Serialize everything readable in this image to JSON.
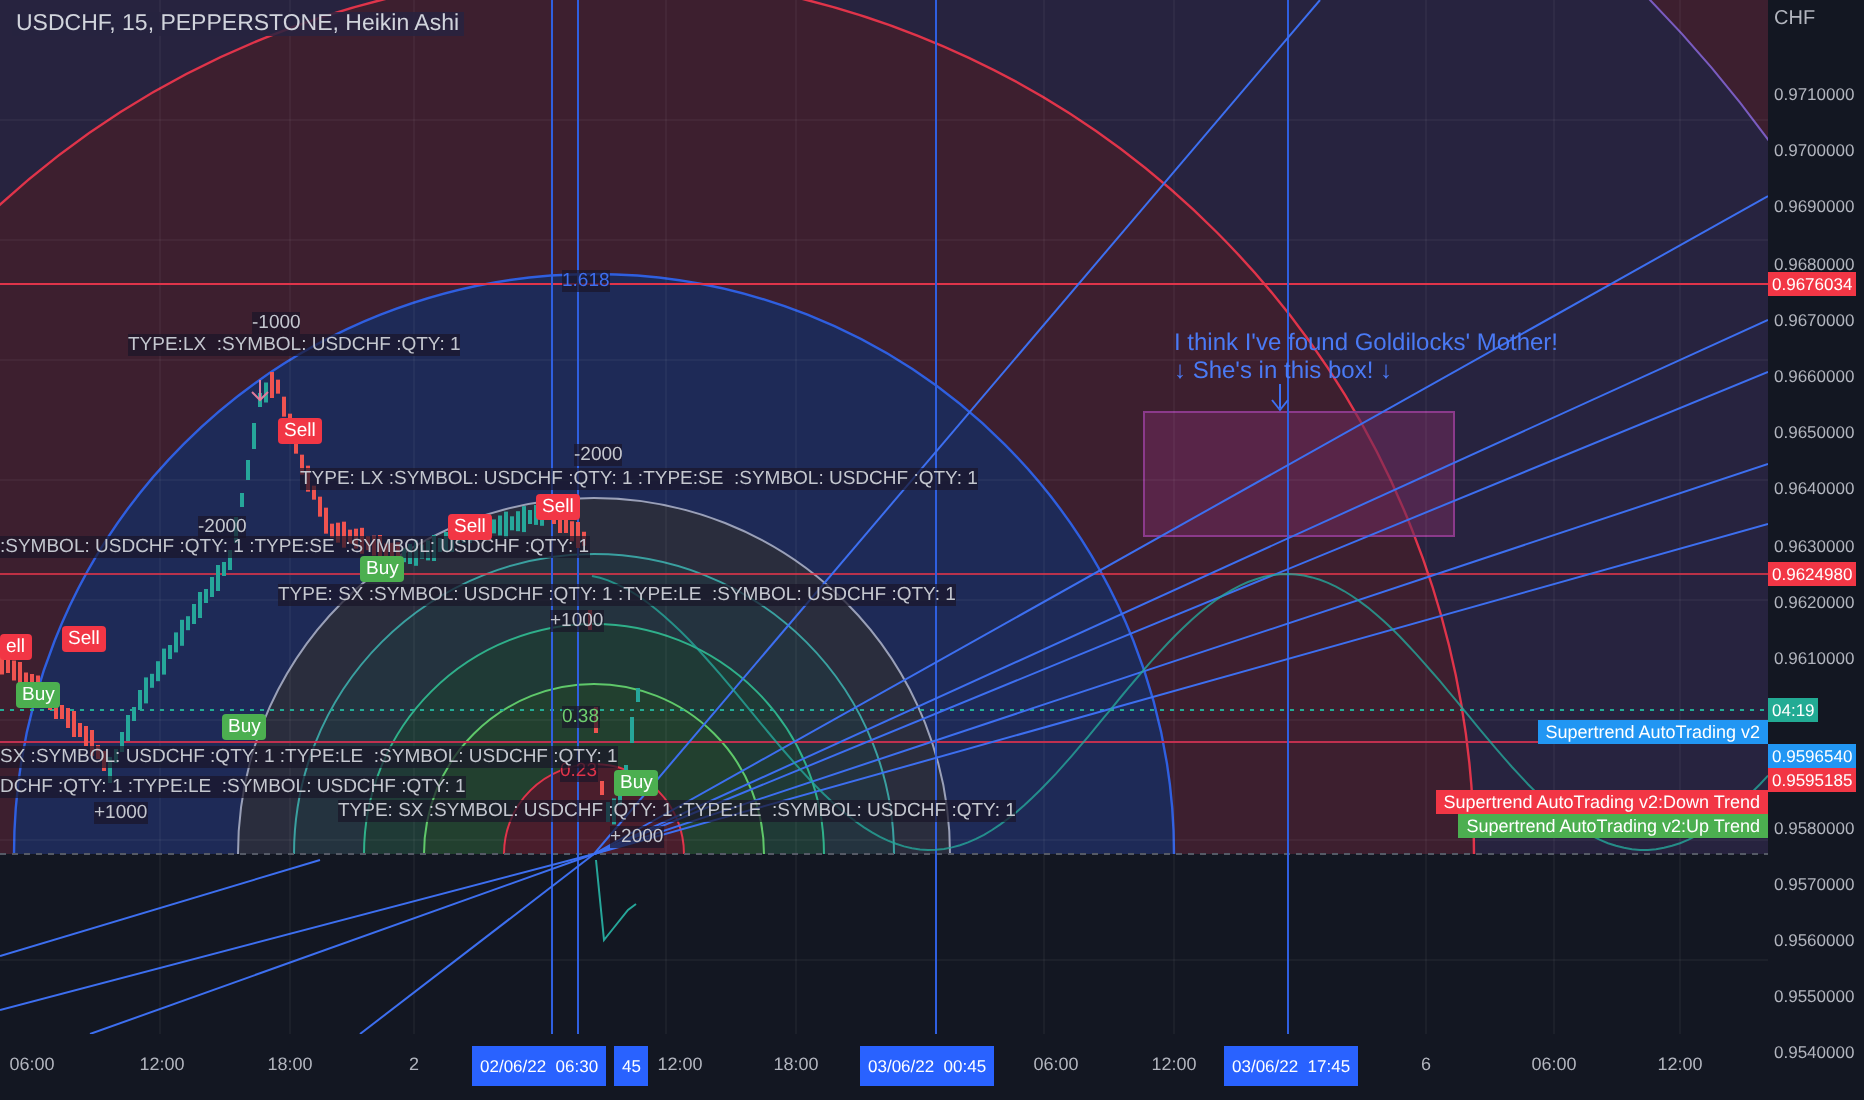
{
  "header": {
    "title": "USDCHF, 15, PEPPERSTONE, Heikin Ashi"
  },
  "chart": {
    "fib_labels": [
      "1.618",
      "0.38",
      "0.23"
    ],
    "note": [
      "I think I've found Goldilocks' Mother!",
      "↓ She's in this box! ↓"
    ],
    "trade_texts": [
      "-1000",
      "TYPE:LX  :SYMBOL: USDCHF :QTY: 1",
      "-2000",
      "TYPE: LX :SYMBOL: USDCHF :QTY: 1 :TYPE:SE  :SYMBOL: USDCHF :QTY: 1",
      "-2000",
      ":SYMBOL: USDCHF :QTY: 1 :TYPE:SE  :SYMBOL: USDCHF :QTY: 1",
      "TYPE: SX :SYMBOL: USDCHF :QTY: 1 :TYPE:LE  :SYMBOL: USDCHF :QTY: 1",
      "+1000",
      "SX :SYMBOL: USDCHF :QTY: 1 :TYPE:LE  :SYMBOL: USDCHF :QTY: 1",
      "DCHF :QTY: 1 :TYPE:LE  :SYMBOL: USDCHF :QTY: 1",
      "+1000",
      "TYPE: SX :SYMBOL: USDCHF :QTY: 1 :TYPE:LE  :SYMBOL: USDCHF :QTY: 1",
      "+2000"
    ],
    "signals": [
      {
        "kind": "sell",
        "label": "Sell"
      },
      {
        "kind": "sell",
        "label": "ell"
      },
      {
        "kind": "sell",
        "label": "Sell"
      },
      {
        "kind": "sell",
        "label": "Sell"
      },
      {
        "kind": "sell",
        "label": "Sell"
      },
      {
        "kind": "buy",
        "label": "Buy"
      },
      {
        "kind": "buy",
        "label": "Buy"
      },
      {
        "kind": "buy",
        "label": "Buy"
      },
      {
        "kind": "buy",
        "label": "Buy"
      }
    ],
    "tags": [
      {
        "label": "Supertrend AutoTrading v2",
        "color": "#2196f3"
      },
      {
        "label": "Supertrend AutoTrading v2:Down Trend",
        "color": "#f23645"
      },
      {
        "label": "Supertrend AutoTrading v2:Up Trend",
        "color": "#4caf50"
      }
    ]
  },
  "price_axis": {
    "currency": "CHF",
    "ticks": [
      "0.9710000",
      "0.9700000",
      "0.9690000",
      "0.9680000",
      "0.9670000",
      "0.9660000",
      "0.9650000",
      "0.9640000",
      "0.9630000",
      "0.9620000",
      "0.9610000",
      "0.9580000",
      "0.9570000",
      "0.9560000",
      "0.9550000",
      "0.9540000"
    ],
    "markers": [
      {
        "value": "0.9676034",
        "color": "#f23645"
      },
      {
        "value": "0.9624980",
        "color": "#f23645"
      },
      {
        "value": "04:19",
        "color": "#22ab94"
      },
      {
        "value": "0.9596540",
        "color": "#2196f3"
      },
      {
        "value": "0.9595185",
        "color": "#f23645"
      }
    ]
  },
  "time_axis": {
    "ticks": [
      "06:00",
      "12:00",
      "18:00",
      "2",
      "12:00",
      "18:00",
      "06:00",
      "12:00",
      "6",
      "06:00",
      "12:00"
    ],
    "markers": [
      "02/06/22  06:30",
      "45",
      "03/06/22  00:45",
      "03/06/22  17:45"
    ]
  }
}
